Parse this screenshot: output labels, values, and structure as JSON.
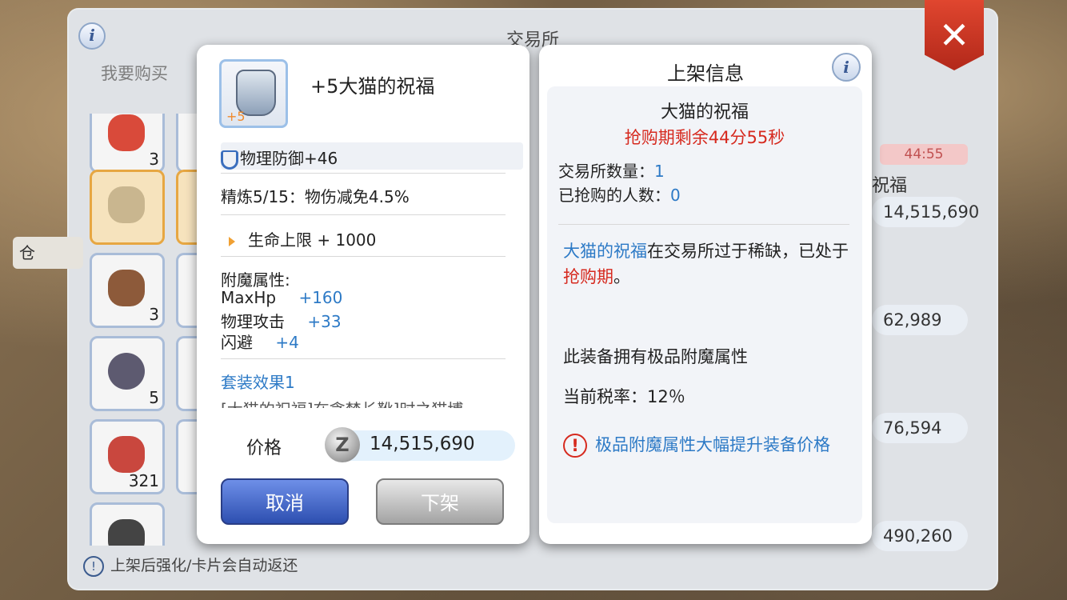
{
  "exchange": {
    "title": "交易所",
    "info_glyph": "i",
    "tab_buy": "我要购买",
    "close_glyph": "✕",
    "side_label": "仓",
    "bottom_note": "上架后强化/卡片会自动返还",
    "note_glyph": "!",
    "grid_counts": [
      "3",
      "3",
      "5",
      "321"
    ],
    "right_list": {
      "timer": "44:55",
      "item_fragment": "祝福",
      "prices": [
        "14,515,690",
        "62,989",
        "76,594",
        "490,260"
      ]
    }
  },
  "item_panel": {
    "name": "+5大猫的祝福",
    "refine_badge": "+5",
    "phys_def": "物理防御+46",
    "refine": "精炼5/15：物伤减免4.5%",
    "hp_bonus": "生命上限 + 1000",
    "enchant_title": "附魔属性:",
    "enchants": [
      {
        "label": "MaxHp",
        "value": "+160"
      },
      {
        "label": "物理攻击",
        "value": "+33"
      },
      {
        "label": "闪避",
        "value": "+4"
      }
    ],
    "set_effect": "套装效果1",
    "set_desc": "[大猫的祝福]在贪婪长靴]时之猫博",
    "price_label": "价格",
    "zeny_glyph": "Z",
    "price": "14,515,690",
    "cancel_label": "取消",
    "delist_label": "下架"
  },
  "listing_panel": {
    "title": "上架信息",
    "info_glyph": "i",
    "item_name": "大猫的祝福",
    "rush_timer": "抢购期剩余44分55秒",
    "qty_label": "交易所数量：",
    "qty_value": "1",
    "buyers_label": "已抢购的人数：",
    "buyers_value": "0",
    "scarce_item": "大猫的祝福",
    "scarce_mid": "在交易所过于稀缺，已处于",
    "scarce_period": "抢购期",
    "scarce_end": "。",
    "premium_note": "此装备拥有极品附魔属性",
    "tax": "当前税率：12％",
    "warn_glyph": "!",
    "warning": "极品附魔属性大幅提升装备价格"
  }
}
